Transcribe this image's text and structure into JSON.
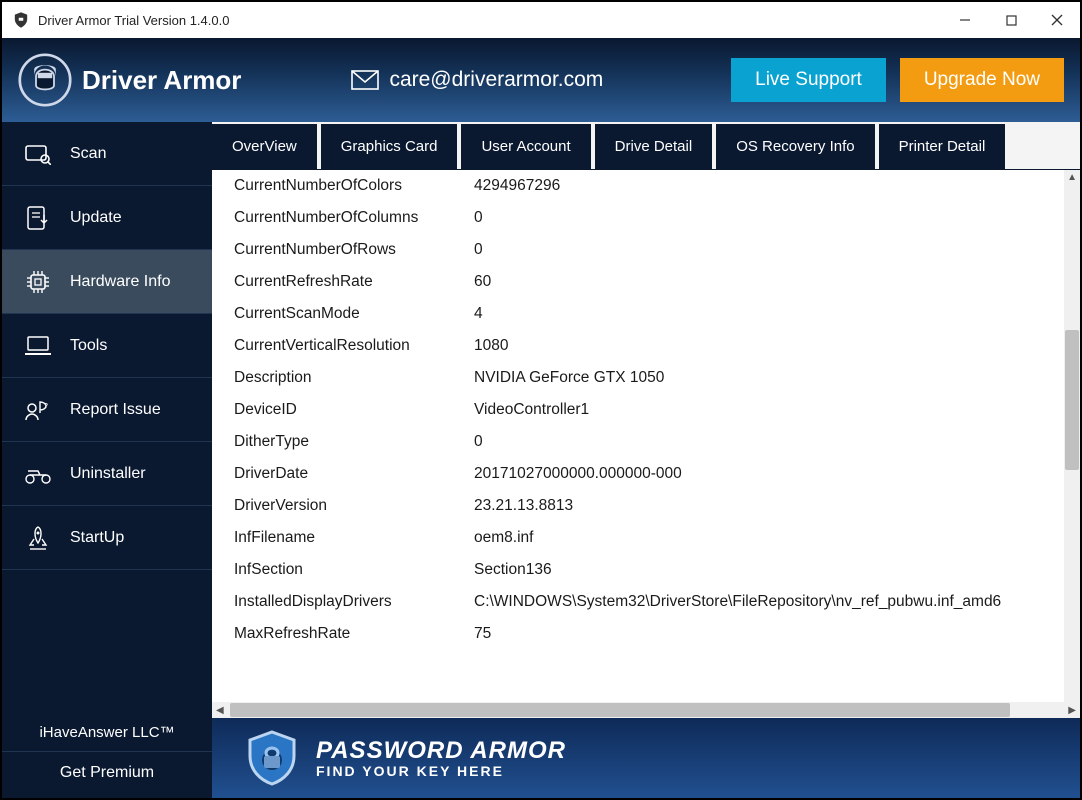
{
  "window": {
    "title": "Driver Armor Trial Version  1.4.0.0"
  },
  "header": {
    "brand": "Driver Armor",
    "email": "care@driverarmor.com",
    "live": "Live Support",
    "upgrade": "Upgrade Now"
  },
  "sidebar": {
    "items": [
      {
        "label": "Scan"
      },
      {
        "label": "Update"
      },
      {
        "label": "Hardware Info"
      },
      {
        "label": "Tools"
      },
      {
        "label": "Report Issue"
      },
      {
        "label": "Uninstaller"
      },
      {
        "label": "StartUp"
      }
    ],
    "footer": "iHaveAnswer LLC™",
    "premium": "Get Premium"
  },
  "tabs": [
    {
      "label": "OverView"
    },
    {
      "label": "Graphics Card"
    },
    {
      "label": "User Account"
    },
    {
      "label": "Drive Detail"
    },
    {
      "label": "OS Recovery Info"
    },
    {
      "label": "Printer Detail"
    }
  ],
  "rows": [
    {
      "k": "CurrentNumberOfColors",
      "v": "4294967296"
    },
    {
      "k": "CurrentNumberOfColumns",
      "v": "0"
    },
    {
      "k": "CurrentNumberOfRows",
      "v": "0"
    },
    {
      "k": "CurrentRefreshRate",
      "v": "60"
    },
    {
      "k": "CurrentScanMode",
      "v": "4"
    },
    {
      "k": "CurrentVerticalResolution",
      "v": "1080"
    },
    {
      "k": "Description",
      "v": "NVIDIA GeForce GTX 1050"
    },
    {
      "k": "DeviceID",
      "v": "VideoController1"
    },
    {
      "k": "DitherType",
      "v": "0"
    },
    {
      "k": "DriverDate",
      "v": "20171027000000.000000-000"
    },
    {
      "k": "DriverVersion",
      "v": "23.21.13.8813"
    },
    {
      "k": "InfFilename",
      "v": "oem8.inf"
    },
    {
      "k": "InfSection",
      "v": "Section136"
    },
    {
      "k": "InstalledDisplayDrivers",
      "v": "C:\\WINDOWS\\System32\\DriverStore\\FileRepository\\nv_ref_pubwu.inf_amd6"
    },
    {
      "k": "MaxRefreshRate",
      "v": "75"
    }
  ],
  "banner": {
    "line1": "PASSWORD ARMOR",
    "line2": "FIND YOUR KEY HERE"
  }
}
